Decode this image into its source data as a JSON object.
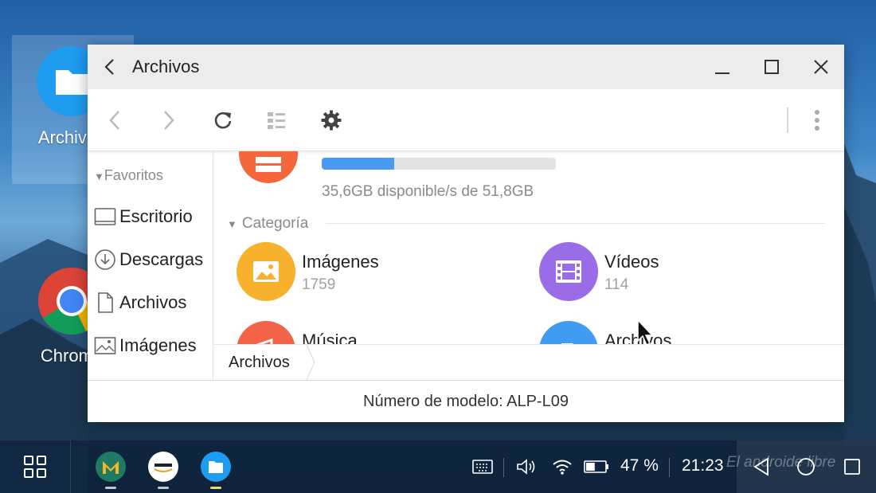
{
  "desktop": {
    "icons": [
      {
        "label": "Archivos",
        "icon": "folder-icon"
      },
      {
        "label": "Chrome",
        "icon": "chrome-icon"
      }
    ]
  },
  "window": {
    "title": "Archivos",
    "controls": [
      "minimize-icon",
      "maximize-icon",
      "close-icon"
    ],
    "toolbar": [
      "back-arrow-icon",
      "forward-arrow-icon",
      "refresh-icon",
      "view-list-icon",
      "settings-gear-icon",
      "more-vert-icon"
    ],
    "sidebar": {
      "section": "Favoritos",
      "items": [
        {
          "label": "Escritorio",
          "icon": "desktop-icon"
        },
        {
          "label": "Descargas",
          "icon": "download-icon"
        },
        {
          "label": "Archivos",
          "icon": "file-icon"
        },
        {
          "label": "Imágenes",
          "icon": "image-icon"
        }
      ]
    },
    "storage": {
      "used_fraction": 0.31,
      "text": "35,6GB disponible/s de 51,8GB",
      "bar_color": "#4a9bf0"
    },
    "category_header": "Categoría",
    "categories": [
      {
        "name": "Imágenes",
        "count": "1759",
        "color": "#f8b12d",
        "icon": "image-icon"
      },
      {
        "name": "Vídeos",
        "count": "114",
        "color": "#9a6ce8",
        "icon": "film-icon"
      },
      {
        "name": "Música",
        "count": "",
        "color": "#f26348",
        "icon": "music-icon"
      },
      {
        "name": "Archivos",
        "count": "",
        "color": "#3f9cf0",
        "icon": "document-icon"
      }
    ],
    "breadcrumb": "Archivos",
    "status": "Número de modelo: ALP-L09"
  },
  "taskbar": {
    "apps": [
      "app-drawer-icon",
      "gmail-icon",
      "amazon-icon",
      "files-icon"
    ],
    "battery": "47 %",
    "time": "21:23",
    "watermark": "El androide libre"
  }
}
